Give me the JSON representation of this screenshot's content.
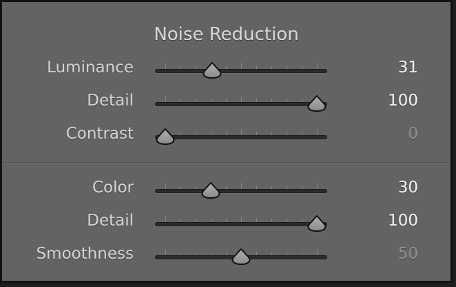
{
  "panel": {
    "title": "Noise Reduction",
    "luminance_sliders": [
      {
        "label": "Luminance",
        "value": "31",
        "level": 0.31,
        "dimmed": false
      },
      {
        "label": "Detail",
        "value": "100",
        "level": 1.0,
        "dimmed": false
      },
      {
        "label": "Contrast",
        "value": "0",
        "level": 0.0,
        "dimmed": true
      }
    ],
    "color_sliders": [
      {
        "label": "Color",
        "value": "30",
        "level": 0.3,
        "dimmed": false
      },
      {
        "label": "Detail",
        "value": "100",
        "level": 1.0,
        "dimmed": false
      },
      {
        "label": "Smoothness",
        "value": "50",
        "level": 0.5,
        "dimmed": true
      }
    ]
  },
  "colors": {
    "panel_background": "#636363",
    "track": "#2b2b2b",
    "thumb": "#8a8a8a",
    "value_text": "#f4f4f4",
    "dimmed_value_text": "#909090"
  }
}
